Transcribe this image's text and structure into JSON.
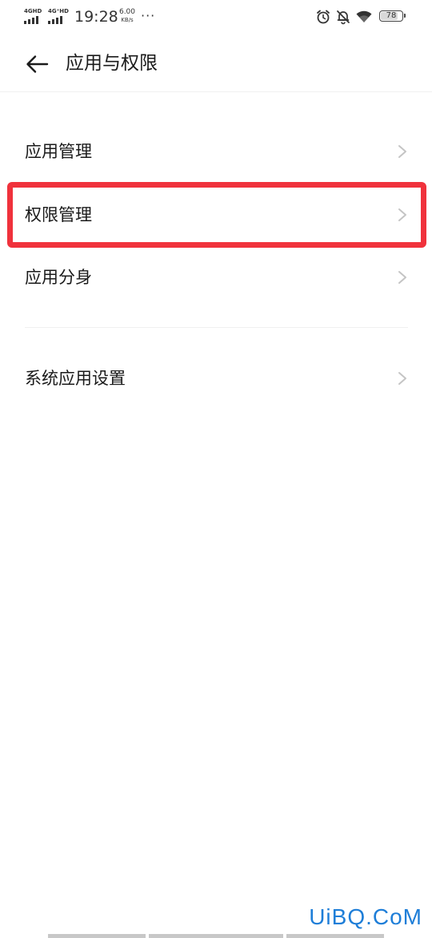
{
  "status_bar": {
    "signal_1": "4GHD",
    "signal_2": "4G⁺HD",
    "time": "19:28",
    "speed_value": "6.00",
    "speed_unit": "KB/s",
    "more": "···",
    "battery": "78",
    "icons": [
      "alarm-icon",
      "bell-off-icon",
      "wifi-icon",
      "battery-icon"
    ]
  },
  "header": {
    "back_icon": "arrow-left-icon",
    "title": "应用与权限"
  },
  "items": [
    {
      "label": "应用管理"
    },
    {
      "label": "权限管理"
    },
    {
      "label": "应用分身"
    },
    {
      "label": "系统应用设置"
    }
  ],
  "highlighted_item": "权限管理",
  "highlight_color": "#f0323c",
  "watermark": "UiBQ.CoM",
  "watermark_color": "#1e7ed8"
}
